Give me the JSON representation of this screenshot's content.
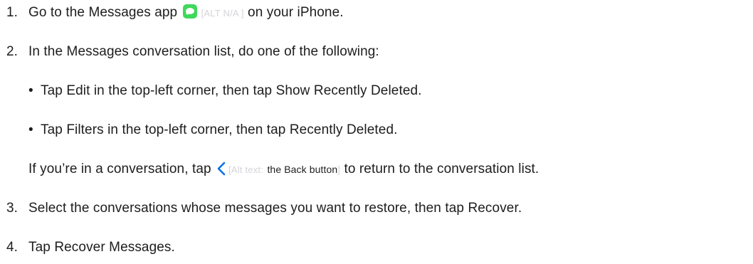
{
  "steps": [
    {
      "number": "1.",
      "text_before": "Go to the Messages app",
      "icon": "messages-app-icon",
      "alt": "[ALT N/A ]",
      "text_after": "on your iPhone."
    },
    {
      "number": "2.",
      "text": "In the Messages conversation list, do one of the following:",
      "bullets": [
        "Tap Edit in the top-left corner, then tap Show Recently Deleted.",
        "Tap Filters in the top-left corner, then tap Recently Deleted."
      ],
      "note": {
        "text_before": "If you’re in a conversation, tap",
        "icon": "chevron-left-icon",
        "alt_prefix": "[Alt text:",
        "alt_label": "the Back button",
        "alt_suffix": "]",
        "text_after": "to return to the conversation list."
      }
    },
    {
      "number": "3.",
      "text": "Select the conversations whose messages you want to restore, then tap Recover."
    },
    {
      "number": "4.",
      "text": "Tap Recover Messages."
    }
  ],
  "colors": {
    "text": "#1d1d1f",
    "alt_faint": "#d4d4d8",
    "messages_green": "#3ed85b",
    "link_blue": "#0071e3"
  }
}
